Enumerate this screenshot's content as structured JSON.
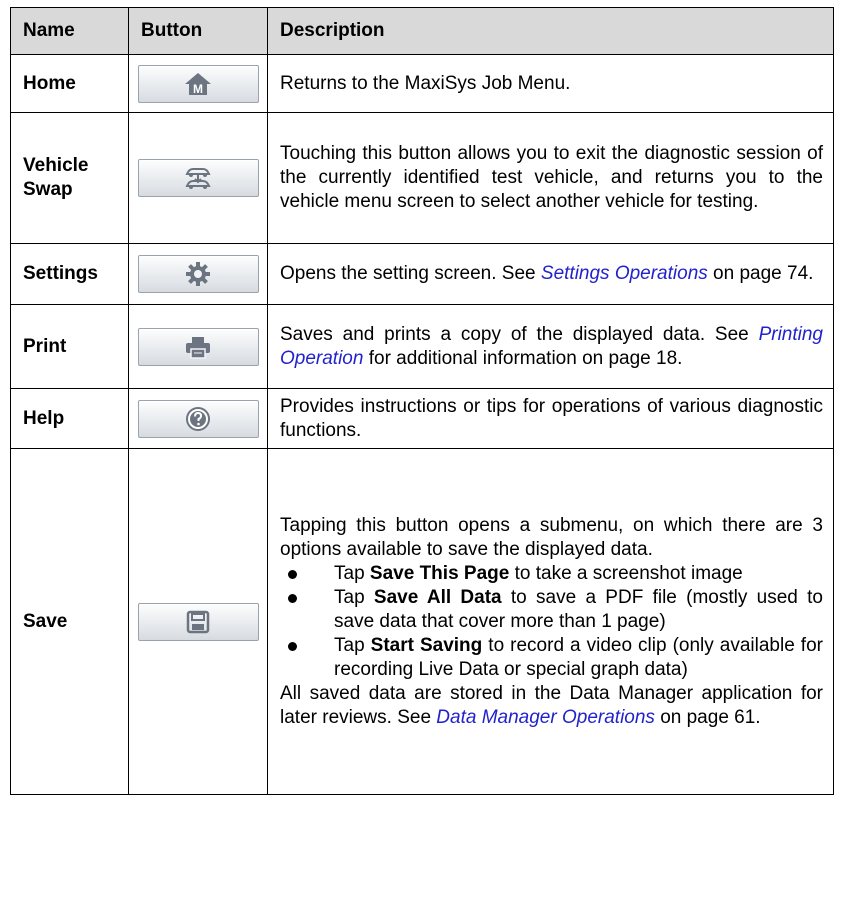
{
  "header": {
    "name": "Name",
    "button": "Button",
    "description": "Description"
  },
  "rows": {
    "home": {
      "name": "Home",
      "icon": "home-icon",
      "desc": "Returns to the MaxiSys Job Menu."
    },
    "vehicle_swap": {
      "name_line1": "Vehicle",
      "name_line2": "Swap",
      "icon": "vehicle-swap-icon",
      "desc": "Touching this button allows you to exit the diagnostic session of the currently identified test vehicle, and returns you to the vehicle menu screen to select another vehicle for testing."
    },
    "settings": {
      "name": "Settings",
      "icon": "gear-icon",
      "desc_pre": "Opens the setting screen. See ",
      "desc_link": "Settings Operations",
      "desc_post": " on page 74."
    },
    "print": {
      "name": "Print",
      "icon": "printer-icon",
      "desc_pre": "Saves and prints a copy of the displayed data. See ",
      "desc_link": "Printing Operation",
      "desc_post": " for additional information on page 18."
    },
    "help": {
      "name": "Help",
      "icon": "help-icon",
      "desc": "Provides instructions or tips for operations of various diagnostic functions."
    },
    "save": {
      "name": "Save",
      "icon": "floppy-disk-icon",
      "intro": "Tapping this button opens a submenu, on which there are 3 options available to save the displayed data.",
      "bullets": [
        {
          "pre": "Tap ",
          "bold": "Save This Page",
          "post": " to take a screenshot image"
        },
        {
          "pre": "Tap ",
          "bold": "Save All Data",
          "post": " to save a PDF file (mostly used to save data that cover more than 1 page)"
        },
        {
          "pre": "Tap ",
          "bold": "Start Saving",
          "post": " to record a video clip (only available for recording Live Data or special graph data)"
        }
      ],
      "outro_pre": "All saved data are stored in the Data Manager application for later reviews. See ",
      "outro_link": "Data Manager Operations",
      "outro_post": " on page 61."
    }
  },
  "colors": {
    "header_bg": "#d9d9d9",
    "link": "#2222cc",
    "icon": "#6b7480"
  }
}
